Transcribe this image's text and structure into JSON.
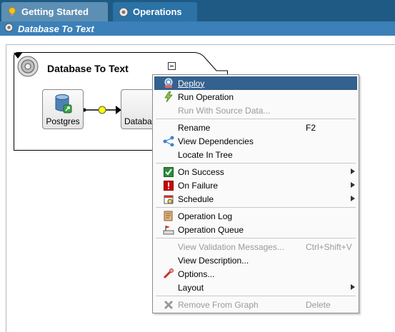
{
  "tabs": [
    {
      "label": "Getting Started",
      "icon": "lightbulb-icon",
      "active": false
    },
    {
      "label": "Operations",
      "icon": "gear-icon",
      "active": true
    }
  ],
  "subtitle": {
    "icon": "gear-icon",
    "text": "Database To Text"
  },
  "graph": {
    "title": "Database To Text",
    "components": [
      {
        "label": "Postgres",
        "icon": "database-icon"
      },
      {
        "label": "Databa",
        "icon": "blank"
      }
    ]
  },
  "menu": {
    "items": [
      {
        "label": "Deploy",
        "icon": "deploy-icon",
        "state": "selected"
      },
      {
        "label": "Run Operation",
        "icon": "run-icon"
      },
      {
        "label": "Run With Source Data...",
        "icon": "none",
        "state": "disabled"
      },
      {
        "label": "Rename",
        "shortcut": "F2"
      },
      {
        "label": "View Dependencies",
        "icon": "dependencies-icon"
      },
      {
        "label": "Locate In Tree"
      },
      {
        "label": "On Success",
        "icon": "success-icon",
        "submenu": true
      },
      {
        "label": "On Failure",
        "icon": "failure-icon",
        "submenu": true
      },
      {
        "label": "Schedule",
        "icon": "schedule-icon",
        "submenu": true
      },
      {
        "label": "Operation Log",
        "icon": "log-icon"
      },
      {
        "label": "Operation Queue",
        "icon": "queue-icon"
      },
      {
        "label": "View Validation Messages...",
        "shortcut": "Ctrl+Shift+V",
        "state": "disabled"
      },
      {
        "label": "View Description..."
      },
      {
        "label": "Options...",
        "icon": "options-icon"
      },
      {
        "label": "Layout",
        "submenu": true
      },
      {
        "label": "Remove From Graph",
        "icon": "remove-icon",
        "shortcut": "Delete",
        "state": "disabled"
      }
    ]
  },
  "colors": {
    "tabbar": "#1f5a85",
    "subbar": "#3b80b8",
    "menu_selection": "#34618d"
  }
}
